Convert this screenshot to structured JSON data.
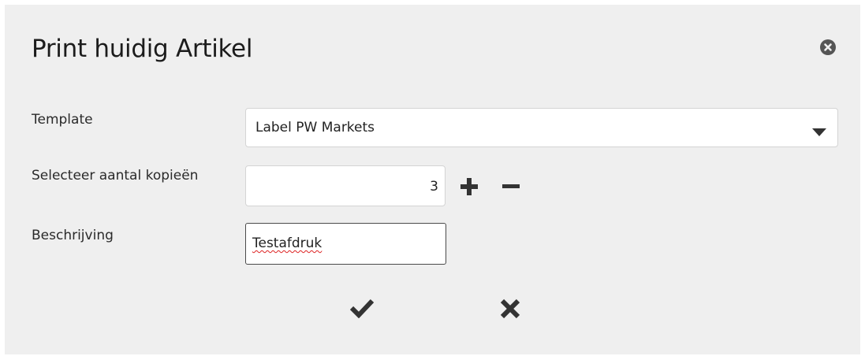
{
  "dialog": {
    "title": "Print huidig Artikel",
    "close_icon": "close-circle-icon"
  },
  "form": {
    "template": {
      "label": "Template",
      "selected": "Label PW Markets",
      "icon": "caret-down-icon"
    },
    "copies": {
      "label": "Selecteer aantal kopieën",
      "value": "3",
      "increment_icon": "plus-icon",
      "decrement_icon": "minus-icon"
    },
    "description": {
      "label": "Beschrijving",
      "value": "Testafdruk"
    }
  },
  "actions": {
    "confirm_icon": "checkmark-icon",
    "cancel_icon": "cross-icon"
  },
  "colors": {
    "background": "#efefef",
    "icon": "#333333",
    "spellcheck_underline": "#dd2222"
  }
}
